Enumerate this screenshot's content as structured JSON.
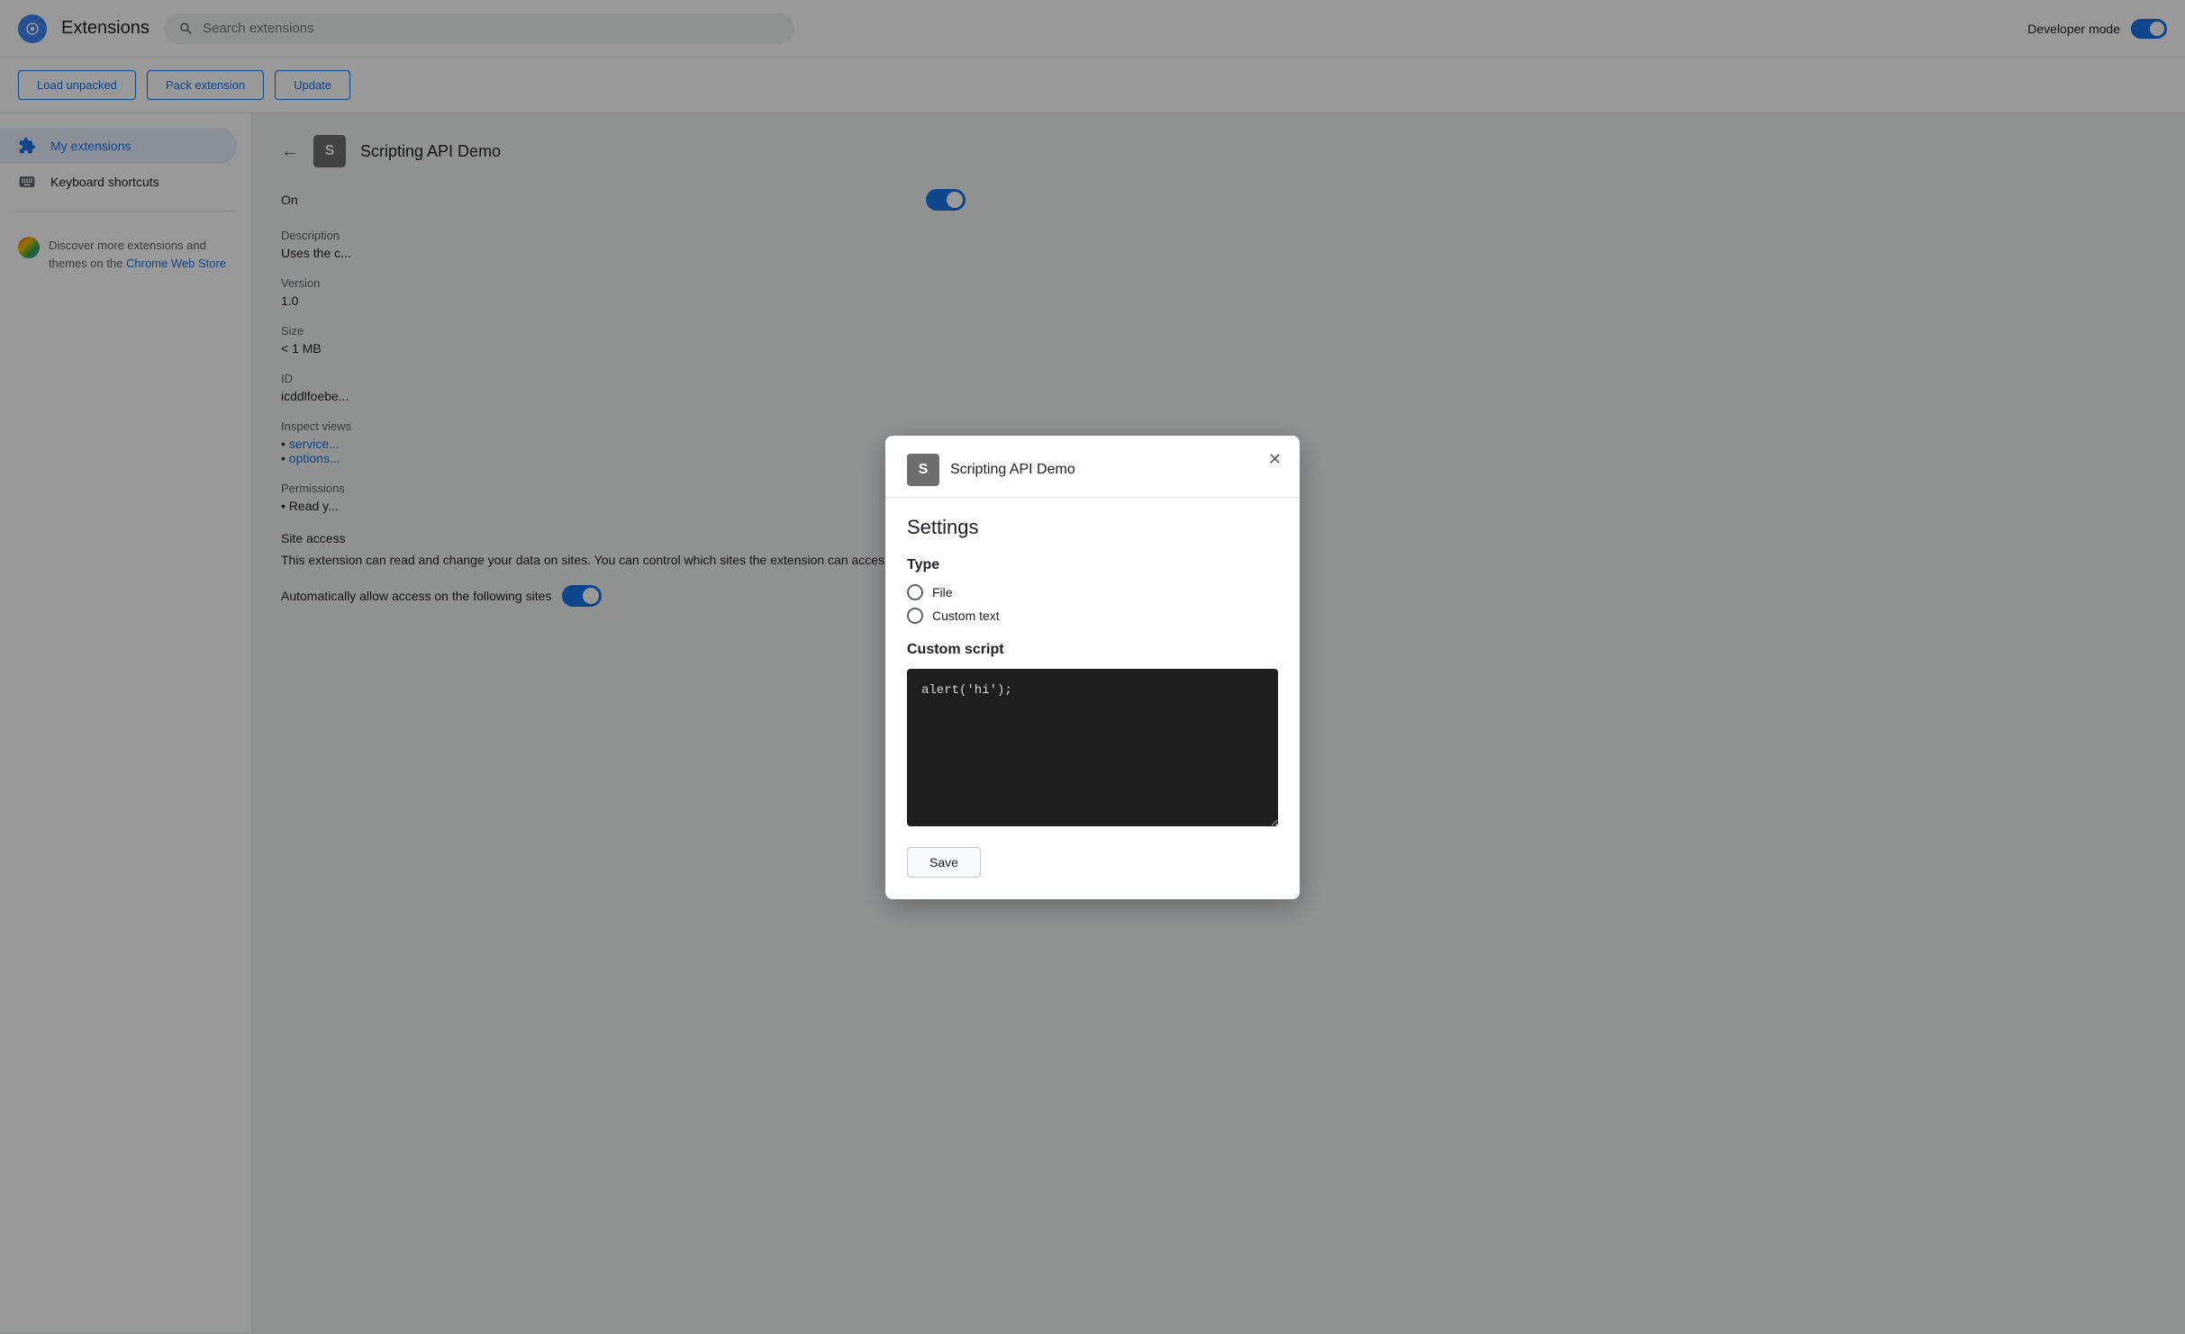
{
  "topBar": {
    "logoAlt": "Chrome Extensions logo",
    "title": "Extensions",
    "search": {
      "placeholder": "Search extensions",
      "value": ""
    },
    "devMode": {
      "label": "Developer mode",
      "enabled": true
    }
  },
  "toolbar": {
    "loadUnpacked": "Load unpacked",
    "packExtension": "Pack extension",
    "update": "Update"
  },
  "sidebar": {
    "myExtensions": "My extensions",
    "keyboardShortcuts": "Keyboard shortcuts",
    "discover": {
      "text": "Discover more extensions and themes on the ",
      "linkText": "Chrome Web Store"
    }
  },
  "extensionDetail": {
    "backLabel": "←",
    "iconLetter": "S",
    "name": "Scripting API Demo",
    "statusLabel": "On",
    "toggleEnabled": true,
    "fields": {
      "descriptionLabel": "Description",
      "descriptionValue": "Uses the c...",
      "versionLabel": "Version",
      "versionValue": "1.0",
      "sizeLabel": "Size",
      "sizeValue": "< 1 MB",
      "idLabel": "ID",
      "idValue": "icddlfoebe...",
      "inspectLabel": "Inspect views",
      "inspectLinks": [
        "service...",
        "options..."
      ],
      "permissionsLabel": "Permissions",
      "permissionsValue": "Read y...",
      "siteAccessTitle": "Site access",
      "siteAccessText": "This extension can read and change your data on sites. You can control which sites the extension can access.",
      "autoAllowLabel": "Automatically allow access on the following sites"
    }
  },
  "dialog": {
    "iconLetter": "S",
    "extensionName": "Scripting API Demo",
    "settingsTitle": "Settings",
    "typeSection": "Type",
    "typeOptions": [
      {
        "label": "File",
        "selected": false
      },
      {
        "label": "Custom text",
        "selected": false
      }
    ],
    "customScriptTitle": "Custom script",
    "codeValue": "alert('hi');",
    "saveLabel": "Save",
    "closeAriaLabel": "Close"
  }
}
